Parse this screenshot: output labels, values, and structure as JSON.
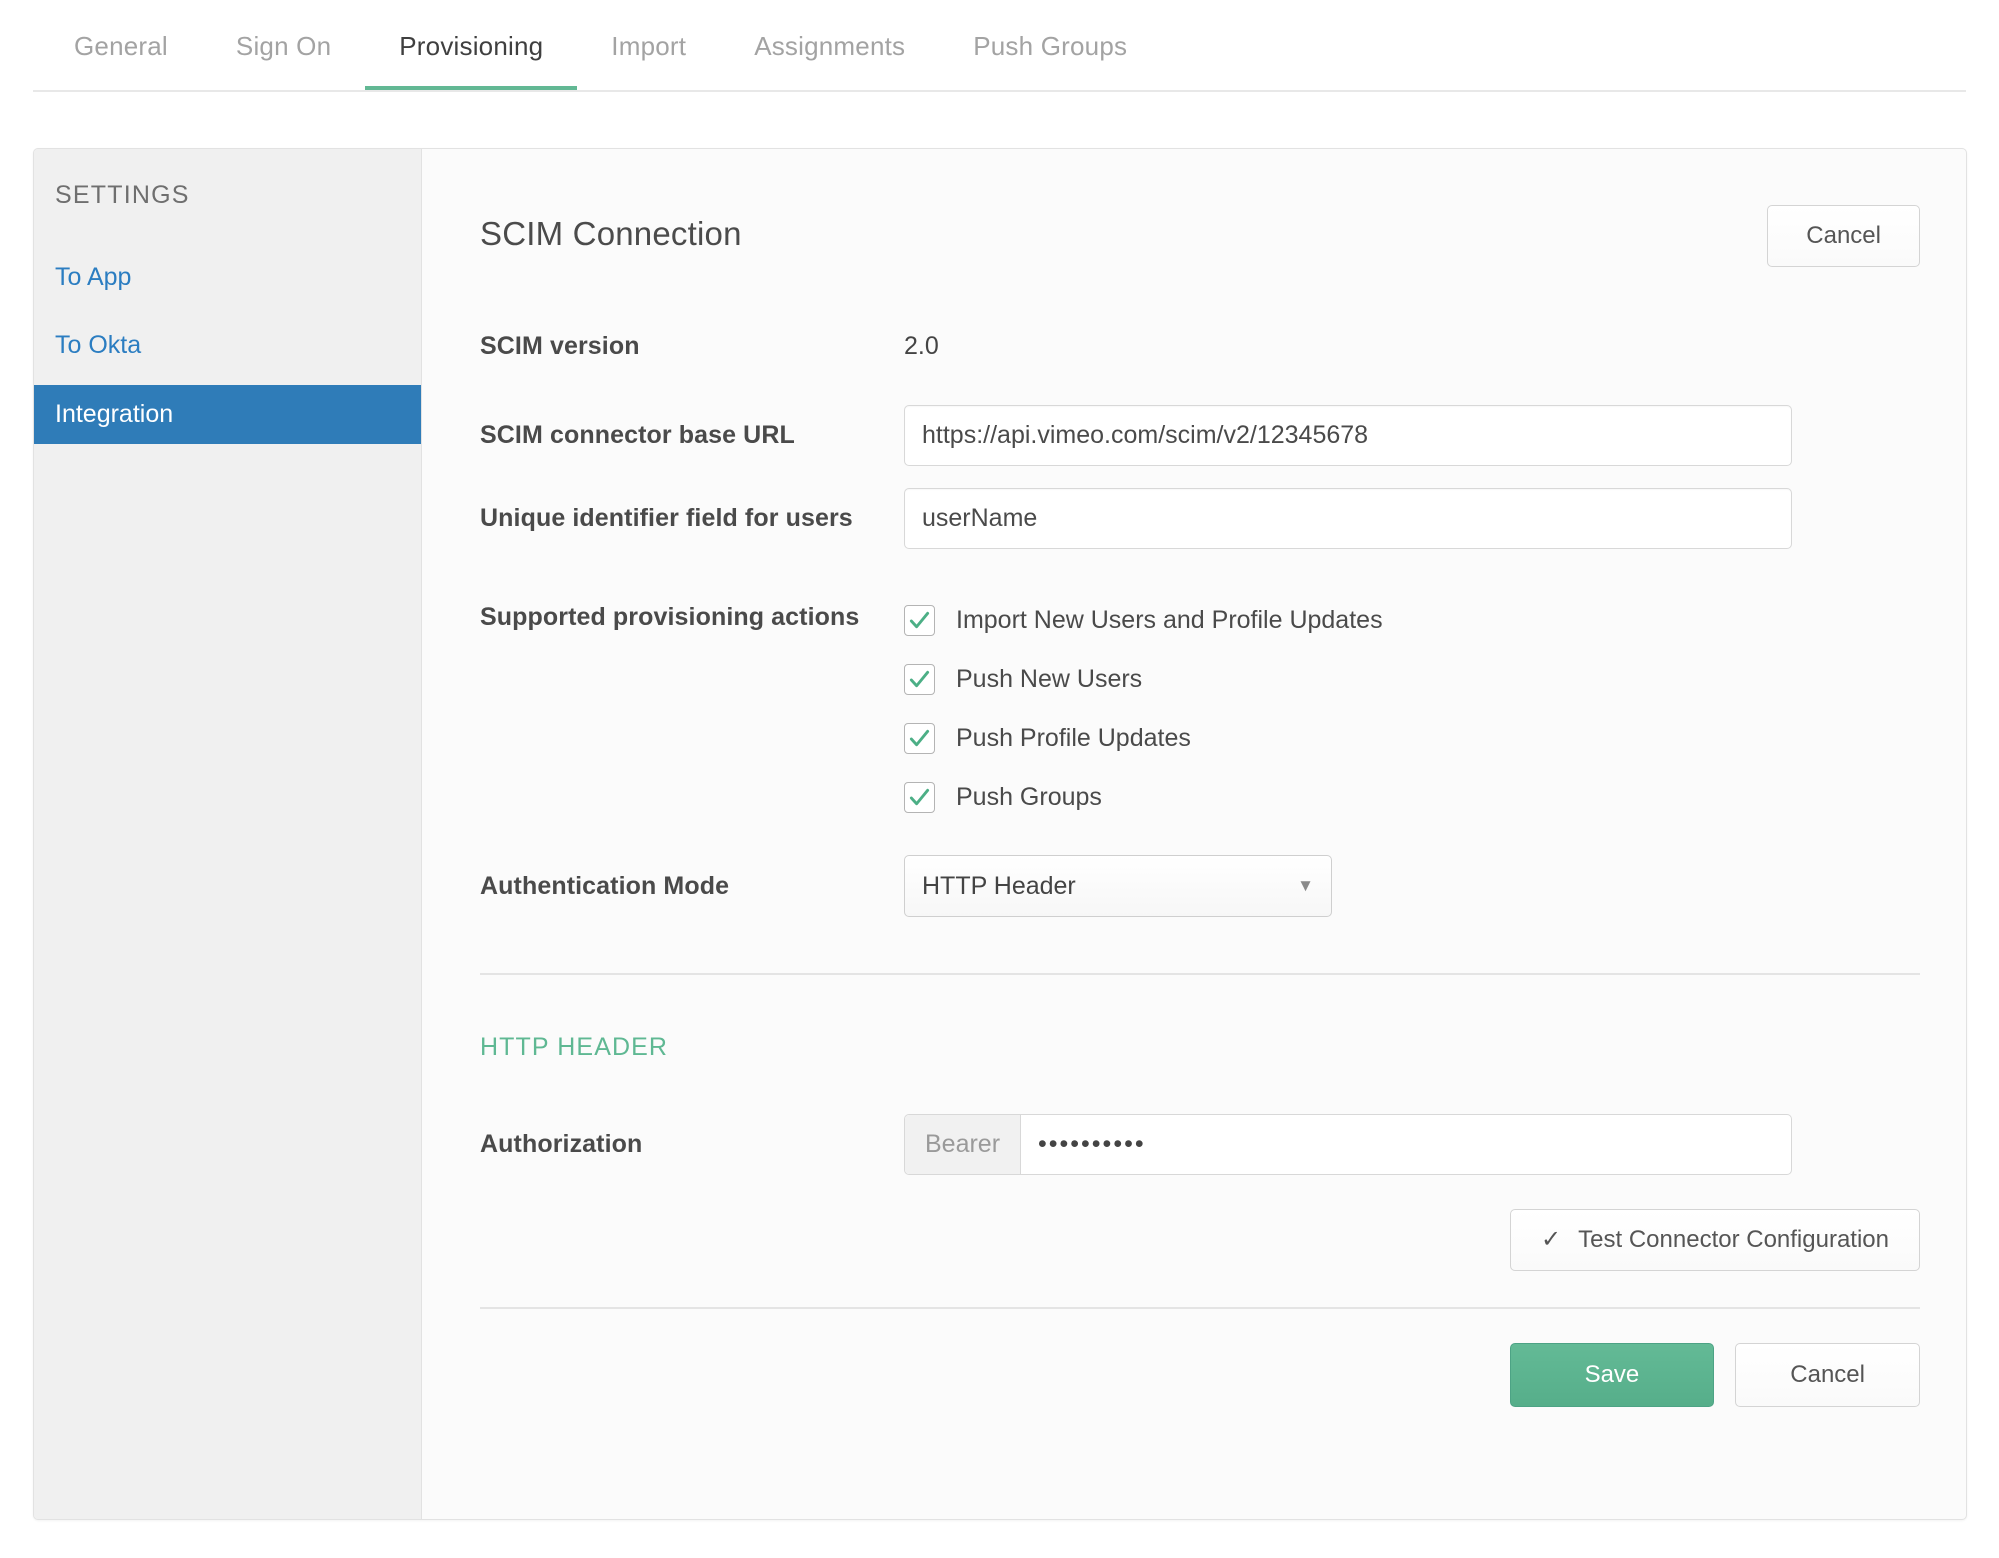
{
  "tabs": [
    {
      "label": "General",
      "active": false
    },
    {
      "label": "Sign On",
      "active": false
    },
    {
      "label": "Provisioning",
      "active": true
    },
    {
      "label": "Import",
      "active": false
    },
    {
      "label": "Assignments",
      "active": false
    },
    {
      "label": "Push Groups",
      "active": false
    }
  ],
  "sidebar": {
    "title": "SETTINGS",
    "items": [
      {
        "label": "To App",
        "active": false
      },
      {
        "label": "To Okta",
        "active": false
      },
      {
        "label": "Integration",
        "active": true
      }
    ]
  },
  "content": {
    "section_title": "SCIM Connection",
    "cancel_top_label": "Cancel",
    "fields": {
      "scim_version_label": "SCIM version",
      "scim_version_value": "2.0",
      "base_url_label": "SCIM connector base URL",
      "base_url_value": "https://api.vimeo.com/scim/v2/12345678",
      "unique_id_label": "Unique identifier field for users",
      "unique_id_value": "userName",
      "provisioning_actions_label": "Supported provisioning actions",
      "auth_mode_label": "Authentication Mode",
      "auth_mode_value": "HTTP Header"
    },
    "provisioning_actions": [
      {
        "label": "Import New Users and Profile Updates",
        "checked": true
      },
      {
        "label": "Push New Users",
        "checked": true
      },
      {
        "label": "Push Profile Updates",
        "checked": true
      },
      {
        "label": "Push Groups",
        "checked": true
      }
    ],
    "auth_mode_options": [
      "HTTP Header"
    ],
    "http_header": {
      "subsection_title": "HTTP HEADER",
      "authorization_label": "Authorization",
      "bearer_prefix": "Bearer",
      "secret_value": "••••••••••"
    },
    "test_button_label": "Test Connector Configuration",
    "save_label": "Save",
    "cancel_label": "Cancel"
  },
  "colors": {
    "accent_green": "#62b894",
    "active_blue": "#2f7cb8",
    "link_blue": "#2b7dc1",
    "check_green": "#4caf86"
  }
}
